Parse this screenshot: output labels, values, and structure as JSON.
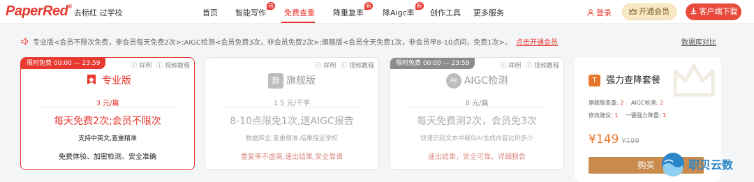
{
  "header": {
    "logo": "PaperRed",
    "logo_mark": "®",
    "slogan": "去标红 过学校",
    "nav": [
      {
        "label": "首页"
      },
      {
        "label": "智能写作",
        "badge": "热"
      },
      {
        "label": "免费查重"
      },
      {
        "label": "降重复率",
        "badge": "新"
      },
      {
        "label": "降Aigc率",
        "badge": "新"
      },
      {
        "label": "创作工具"
      },
      {
        "label": "更多服务"
      }
    ],
    "login": "登录",
    "vip_button": "开通会员",
    "client_button": "客户端下载"
  },
  "notice": {
    "text": "专业版<会员不限次免费，非会员每天免费2次>;AIGC检测<会员免费3次，非会员免费2次>;旗舰版<会员全天免费1次，非会员早8-10点间，免费1次>。",
    "link": "点击开通会员",
    "compare": "数据库对比"
  },
  "cards": [
    {
      "tag": "限时免费 00:00 — 23:59",
      "sample": "样例",
      "video": "视频教程",
      "title": "专业版",
      "price": "3 元/篇",
      "headline": "每天免费2次;会员不限次",
      "sub1": "支持中英文,查重精准",
      "sub2": "免费体验、加密检测、安全准确"
    },
    {
      "sample": "样例",
      "video": "视频教程",
      "icon_text": "旗",
      "title": "旗舰版",
      "price": "1.5 元/千字",
      "headline": "8-10点限免1次,送AIGC报告",
      "sub1": "数据库全,查重精准,结果接近学校",
      "sub2": "重复率不虚高,速出结果,安全靠谱"
    },
    {
      "tag": "限时免费 00:00 — 23:59",
      "sample": "样例",
      "video": "视频教程",
      "icon_text": "AI",
      "title": "AIGC检测",
      "price": "8 元/篇",
      "headline": "每天免费测2次，会员免3次",
      "sub1": "快速识别文本中疑似AI生成内容比例多少",
      "sub2": "速出结果，安全可靠，详细报告"
    }
  ],
  "package": {
    "icon_text": "T",
    "title": "强力查降套餐",
    "rows": [
      [
        {
          "label": "旗舰版查重:",
          "num": "2"
        },
        {
          "label": "AIGC检测:",
          "num": "2"
        }
      ],
      [
        {
          "label": "修改建议:",
          "num": "1"
        },
        {
          "label": "一键强力降重:",
          "num": "1"
        }
      ]
    ],
    "price": "¥149",
    "old_price": "¥199",
    "buy": "购买"
  },
  "watermark": "职贝云数",
  "colors": {
    "brand": "#e8382f",
    "gold": "#c88b4d",
    "orange": "#e8762a"
  }
}
